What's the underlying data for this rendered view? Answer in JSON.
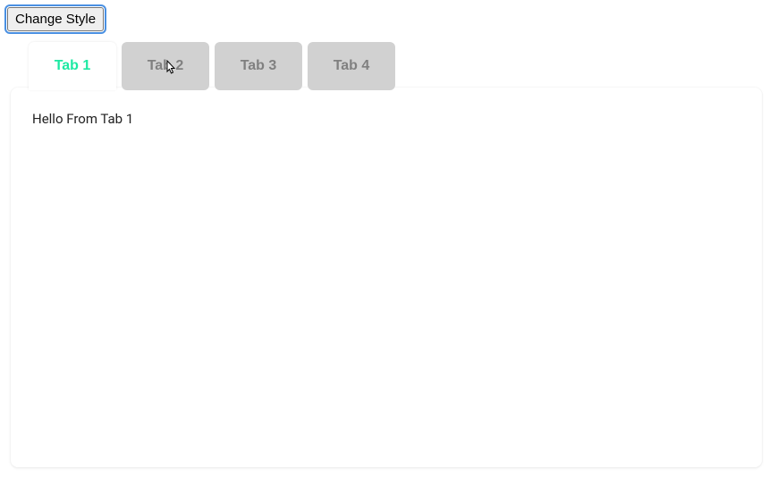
{
  "toolbar": {
    "change_style_label": "Change Style"
  },
  "tabs": {
    "items": [
      {
        "label": "Tab 1",
        "active": true
      },
      {
        "label": "Tab 2",
        "active": false
      },
      {
        "label": "Tab 3",
        "active": false
      },
      {
        "label": "Tab 4",
        "active": false
      }
    ]
  },
  "panel": {
    "content": "Hello From Tab 1"
  },
  "colors": {
    "accent": "#1DE9A3",
    "inactive_tab_bg": "#d1d1d1",
    "inactive_tab_text": "#808080"
  }
}
